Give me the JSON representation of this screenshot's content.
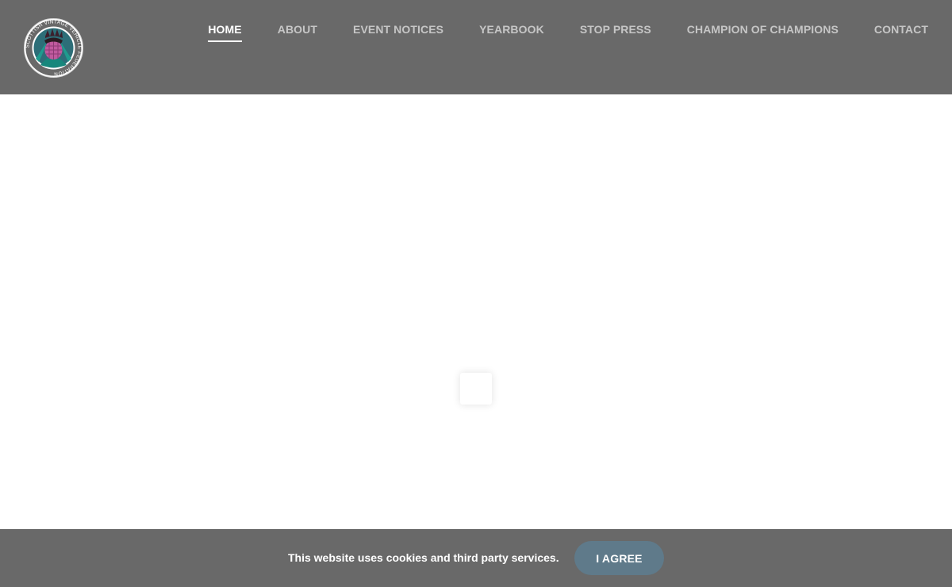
{
  "logo": {
    "text": "SCOTTISH VINTAGE VEHICLE FEDERATION"
  },
  "nav": {
    "items": [
      {
        "label": "HOME",
        "active": true
      },
      {
        "label": "ABOUT"
      },
      {
        "label": "EVENT NOTICES"
      },
      {
        "label": "YEARBOOK"
      },
      {
        "label": "STOP PRESS"
      },
      {
        "label": "CHAMPION OF CHAMPIONS"
      },
      {
        "label": "CONTACT"
      }
    ]
  },
  "cookie": {
    "message": "This website uses cookies and third party services.",
    "agree_label": "I AGREE"
  },
  "colors": {
    "header_bg": "#696969",
    "nav_text": "#c6c6c6",
    "nav_active": "#ffffff",
    "button_bg": "#5f7a8a"
  }
}
